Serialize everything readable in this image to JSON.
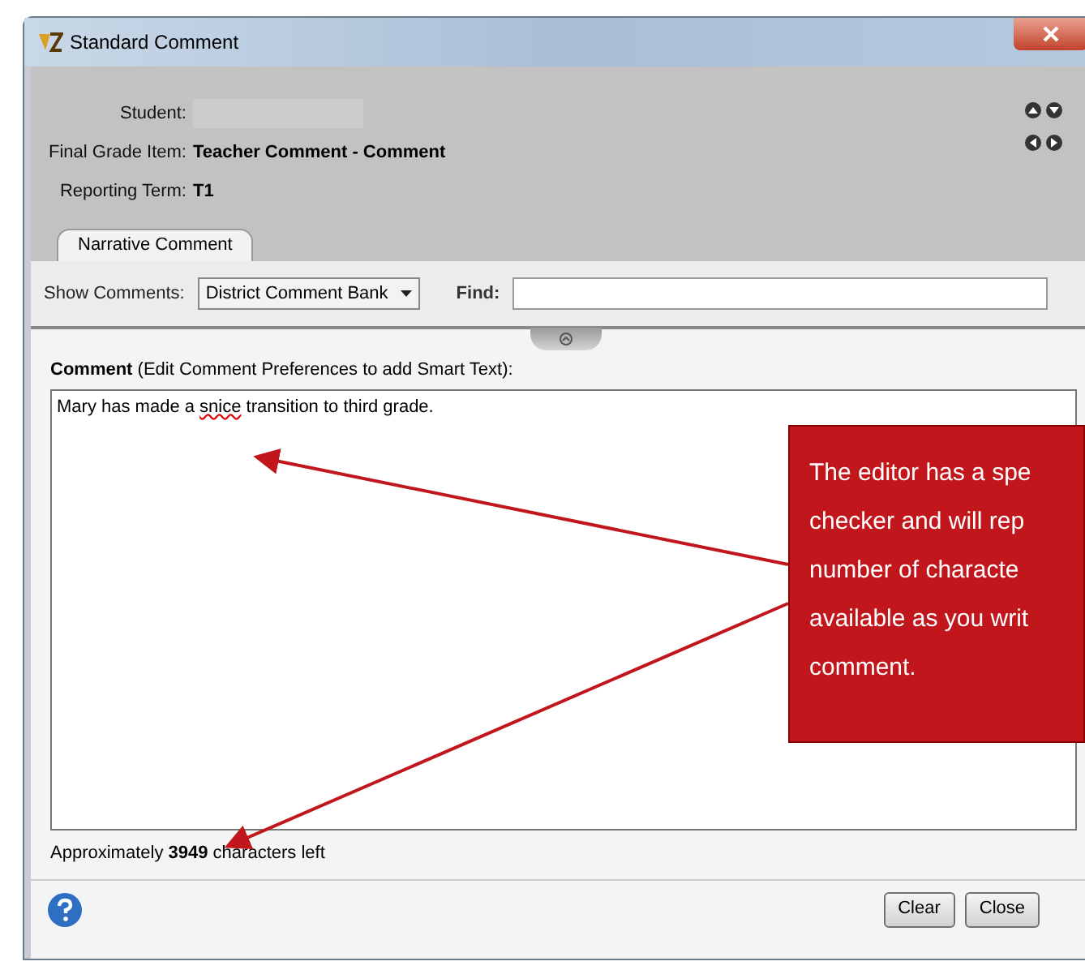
{
  "window": {
    "title": "Standard Comment"
  },
  "fields": [
    {
      "label": "Student:"
    },
    {
      "label": "Final Grade Item:",
      "value": "Teacher Comment - Comment"
    },
    {
      "label": "Reporting Term:",
      "value": "T1"
    }
  ],
  "tabs": [
    {
      "label": "Narrative Comment",
      "selected": true
    }
  ],
  "toolbar": {
    "show_label": "Show Comments:",
    "show_value": "District Comment Bank",
    "find_label": "Find:"
  },
  "comment": {
    "label": "**Comment** (Edit Comment Preferences to add Smart Text):",
    "segments": [
      {
        "text": "Mary has made a ",
        "misspelled": false
      },
      {
        "text": "snice",
        "misspelled": true
      },
      {
        "text": " transition to third grade.",
        "misspelled": false
      }
    ]
  },
  "callout": {
    "lines": [
      "The editor has a spe",
      "checker and will rep",
      "number of characte",
      "available as you writ",
      "comment."
    ]
  },
  "counter": "Approximately **3949** characters left",
  "buttons": [
    "Clear",
    "Close"
  ]
}
